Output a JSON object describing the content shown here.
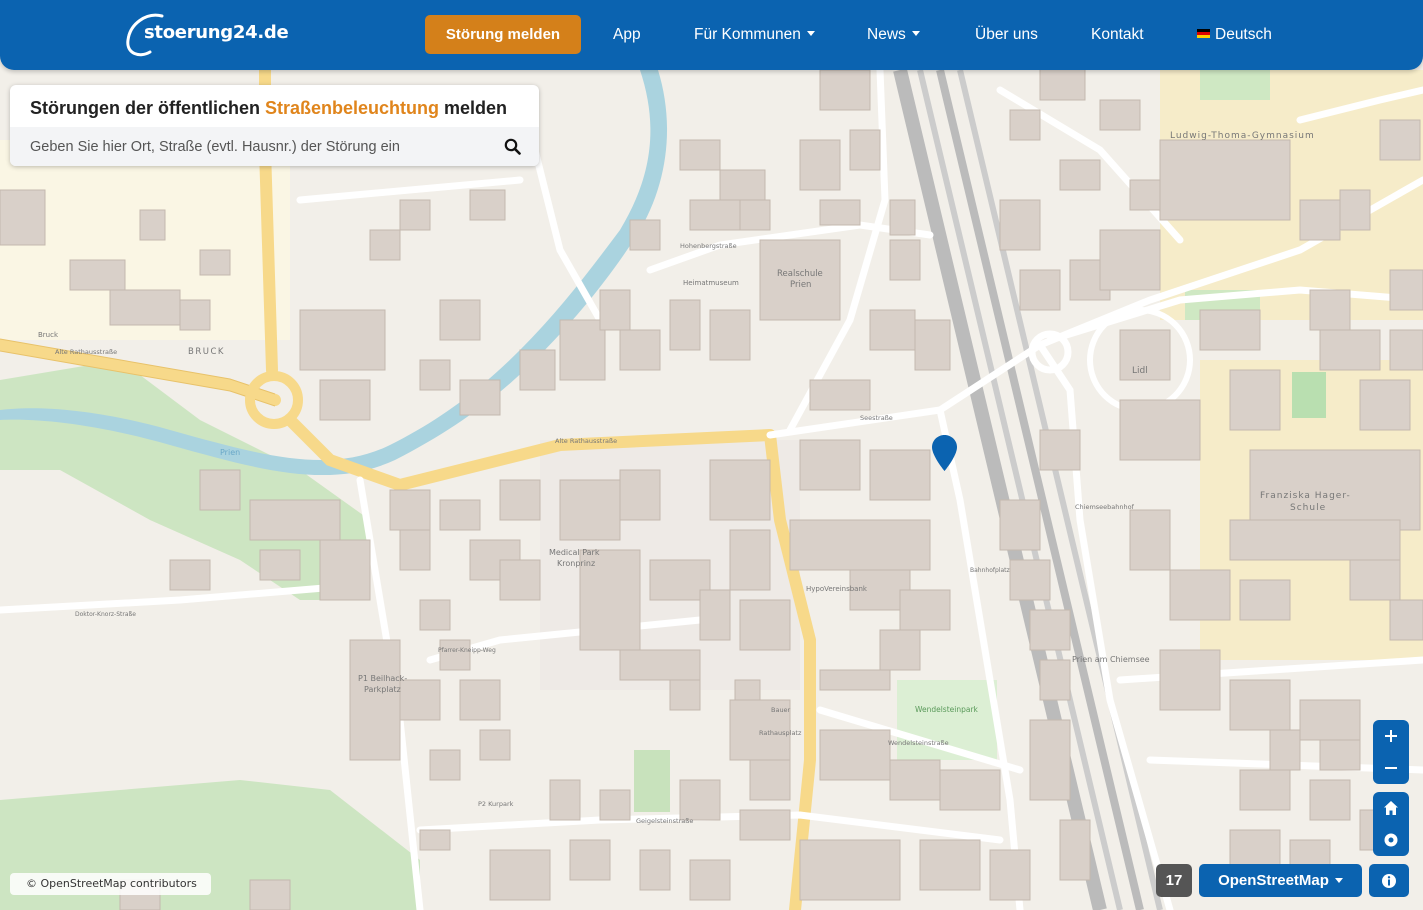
{
  "brand": {
    "name": "stoerung24.de"
  },
  "nav": {
    "report_label": "Störung melden",
    "app_label": "App",
    "municipalities_label": "Für Kommunen",
    "news_label": "News",
    "about_label": "Über uns",
    "contact_label": "Kontakt",
    "language_label": "Deutsch"
  },
  "search": {
    "title_prefix": "Störungen der öffentlichen ",
    "title_highlight": "Straßenbeleuchtung",
    "title_suffix": " melden",
    "placeholder": "Geben Sie hier Ort, Straße (evtl. Hausnr.) der Störung ein"
  },
  "map": {
    "zoom_level": "17",
    "layer_label": "OpenStreetMap",
    "attribution": "© OpenStreetMap contributors",
    "labels": {
      "realschule": "Realschule",
      "prien_realschule": "Prien",
      "heimatmuseum": "Heimatmuseum",
      "bruck": "BRUCK",
      "bruck_small": "Bruck",
      "gymnasium": "Ludwig-Thoma-Gymnasium",
      "medical_park": "Medical Park",
      "kronprinz": "Kronprinz",
      "lidl": "Lidl",
      "franziska_hager": "Franziska Hager-",
      "schule": "Schule",
      "prien_am_chiemsee": "Prien am Chiemsee",
      "wendelsteinpark": "Wendelsteinpark",
      "beilhack_parkplatz": "P1 Beilhack-",
      "parkplatz": "Parkplatz",
      "alte_rathausstrasse": "Alte Rathausstraße",
      "seestrasse": "Seestraße",
      "prien_river": "Prien",
      "hypovereinsbank": "HypoVereinsbank",
      "chiemseebahnhof": "Chiemseebahnhof",
      "bahnhofplatz": "Bahnhofplatz",
      "wendelsteinstrasse": "Wendelsteinstraße",
      "geigelsteinstrasse": "Geigelsteinstraße",
      "kirchplatz": "Pfarrkirche Mariä Himmelfahrt",
      "hohenbergstrasse": "Hohenbergstraße",
      "rathausplatz": "Rathausplatz",
      "doktor_knorz": "Doktor-Knorz-Straße",
      "pfarrer_kneipp": "Pfarrer-Kneipp-Weg",
      "bauer": "Bauer",
      "p2_kurpark": "P2 Kurpark"
    }
  }
}
